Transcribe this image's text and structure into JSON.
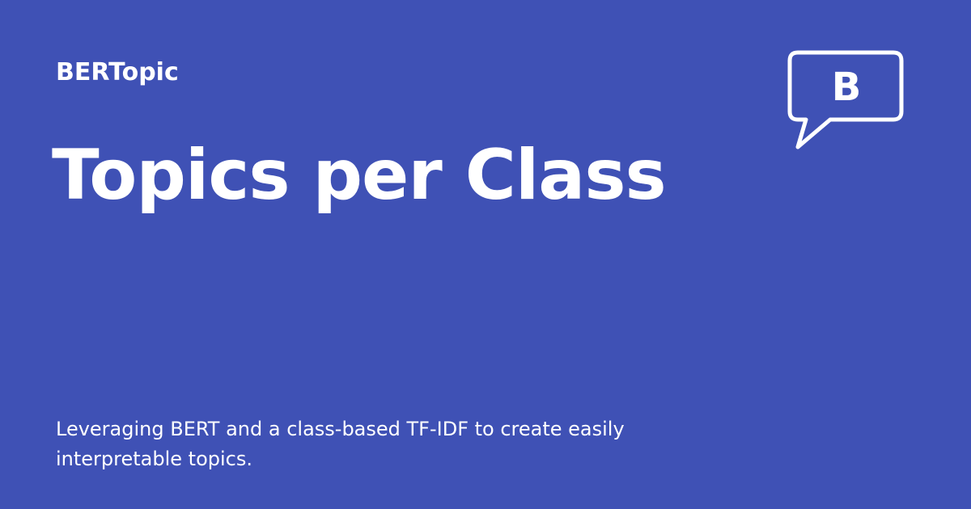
{
  "site": {
    "name": "BERTopic"
  },
  "page": {
    "title": "Topics per Class",
    "description": "Leveraging BERT and a class-based TF-IDF to create easily interpretable topics."
  },
  "logo": {
    "icon": "speech-bubble-logo-icon",
    "letter": "B"
  },
  "colors": {
    "background": "#3F51B5",
    "foreground": "#FFFFFF"
  }
}
